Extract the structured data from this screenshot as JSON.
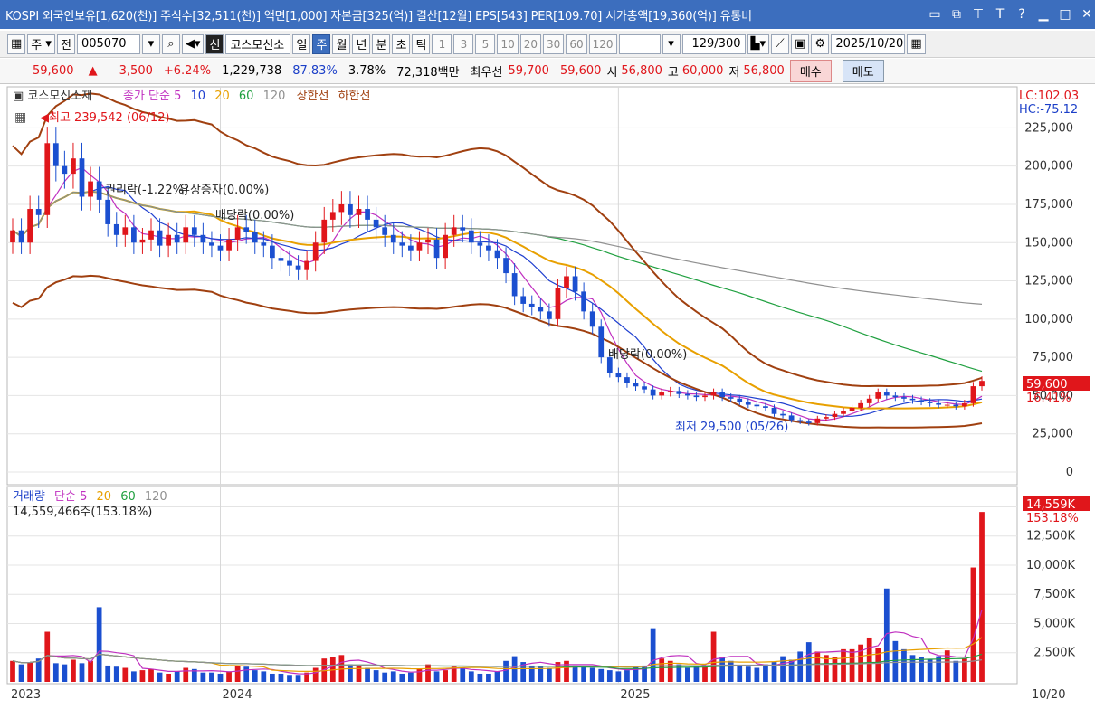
{
  "title_bar": {
    "info": "KOSPI 외국인보유[1,620(천)] 주식수[32,511(천)] 액면[1,000] 자본금[325(억)] 결산[12월] EPS[543] PER[109.70] 시가총액[19,360(억)] 유통비",
    "icons": [
      "layout-icon",
      "window-icon",
      "pin-icon",
      "text-icon",
      "help-icon",
      "minimize-icon",
      "maximize-icon",
      "close-icon"
    ]
  },
  "toolbar": {
    "period_select": "주",
    "prev_label": "전",
    "code": "005070",
    "market_badge": "신",
    "stock_name": "코스모신소",
    "period_tabs": [
      "일",
      "주",
      "월",
      "년"
    ],
    "active_period": "주",
    "interval_tabs": [
      "분",
      "초",
      "틱"
    ],
    "intervals": [
      "1",
      "3",
      "5",
      "10",
      "20",
      "30",
      "60",
      "120"
    ],
    "count": "129/300",
    "date": "2025/10/20"
  },
  "quote": {
    "price": "59,600",
    "arrow": "▲",
    "change": "3,500",
    "change_pct": "+6.24%",
    "volume": "1,229,738",
    "ratio1": "87.83%",
    "ratio2": "3.78%",
    "amount": "72,318백만",
    "best_label": "최우선",
    "best_ask": "59,700",
    "best_bid": "59,600",
    "open_label": "시",
    "open": "56,800",
    "high_label": "고",
    "high": "60,000",
    "low_label": "저",
    "low": "56,800",
    "buy_label": "매수",
    "sell_label": "매도"
  },
  "price_chart": {
    "name": "코스모신소재",
    "legend": [
      {
        "label": "종가 단순 5",
        "color": "#c030c0"
      },
      {
        "label": "10",
        "color": "#2040d0"
      },
      {
        "label": "20",
        "color": "#e8a000"
      },
      {
        "label": "60",
        "color": "#20a040"
      },
      {
        "label": "120",
        "color": "#909090"
      },
      {
        "label": "상한선",
        "color": "#a04010"
      },
      {
        "label": "하한선",
        "color": "#a04010"
      }
    ],
    "lc": "LC:102.03",
    "hc": "HC:-75.12",
    "y_ticks": [
      "225,000",
      "200,000",
      "175,000",
      "150,000",
      "125,000",
      "100,000",
      "75,000",
      "50,000",
      "25,000",
      "0"
    ],
    "high_note": "최고 239,542 (06/12)",
    "low_note": "최저 29,500 (05/26)",
    "events": [
      "권리락(-1.22%)",
      "유상증자(0.00%)",
      "배당락(0.00%)",
      "배당락(0.00%)"
    ],
    "last_price": "59,600",
    "last_pct": "16.41%"
  },
  "volume_chart": {
    "legend_main": "거래량",
    "legend": [
      {
        "label": "단순 5",
        "color": "#c030c0"
      },
      {
        "label": "20",
        "color": "#e8a000"
      },
      {
        "label": "60",
        "color": "#20a040"
      },
      {
        "label": "120",
        "color": "#909090"
      }
    ],
    "readout": "14,559,466주(153.18%)",
    "y_ticks": [
      "15,000K",
      "12,500K",
      "10,000K",
      "7,500K",
      "5,000K",
      "2,500K"
    ],
    "last_vol": "14,559K",
    "last_pct": "153.18%"
  },
  "x_axis": [
    "2023",
    "2024",
    "2025",
    "10/20"
  ],
  "chart_data": {
    "type": "candlestick",
    "price_series_weekly_close": [
      158000,
      150000,
      172000,
      168000,
      215000,
      200000,
      195000,
      205000,
      180000,
      190000,
      178000,
      162000,
      155000,
      160000,
      150000,
      152000,
      158000,
      148000,
      155000,
      150000,
      160000,
      155000,
      150000,
      148000,
      145000,
      152000,
      160000,
      157000,
      150000,
      148000,
      140000,
      138000,
      135000,
      132000,
      138000,
      150000,
      165000,
      170000,
      175000,
      168000,
      172000,
      165000,
      160000,
      155000,
      150000,
      148000,
      145000,
      150000,
      152000,
      140000,
      155000,
      160000,
      158000,
      150000,
      148000,
      145000,
      140000,
      130000,
      115000,
      110000,
      108000,
      105000,
      100000,
      120000,
      128000,
      118000,
      105000,
      95000,
      75000,
      65000,
      62000,
      58000,
      56000,
      54000,
      50000,
      52000,
      53000,
      51000,
      50000,
      49000,
      50000,
      52000,
      49000,
      48000,
      46000,
      44000,
      43000,
      42000,
      38000,
      37000,
      34000,
      33000,
      32000,
      35000,
      36000,
      38000,
      40000,
      42000,
      45000,
      48000,
      52000,
      50000,
      49000,
      48000,
      47000,
      46000,
      45000,
      44000,
      44000,
      43000,
      45000,
      56100,
      59600
    ],
    "volume_series_k": [
      1800,
      1500,
      1700,
      2000,
      4300,
      1600,
      1500,
      1900,
      1600,
      1800,
      6400,
      1400,
      1300,
      1200,
      900,
      1000,
      1100,
      800,
      700,
      900,
      1200,
      1100,
      800,
      800,
      700,
      900,
      1400,
      1300,
      1000,
      900,
      700,
      700,
      600,
      600,
      800,
      1200,
      2000,
      2100,
      2300,
      1500,
      1400,
      1200,
      1000,
      800,
      900,
      700,
      800,
      1100,
      1500,
      900,
      1000,
      1300,
      1200,
      900,
      700,
      700,
      900,
      1800,
      2200,
      1700,
      1400,
      1300,
      1200,
      1700,
      1800,
      1400,
      1300,
      1200,
      1100,
      1000,
      900,
      1000,
      1300,
      1400,
      4600,
      2000,
      1800,
      1500,
      1200,
      1400,
      1300,
      4300,
      2100,
      1800,
      1400,
      1300,
      1200,
      1500,
      1700,
      2200,
      1900,
      2600,
      3400,
      2600,
      2300,
      2100,
      2800,
      2800,
      3200,
      3800,
      2900,
      8000,
      3500,
      2800,
      2300,
      2100,
      1900,
      2200,
      2700,
      1800,
      2000,
      9800,
      14559
    ],
    "ylim": [
      0,
      240000
    ]
  }
}
